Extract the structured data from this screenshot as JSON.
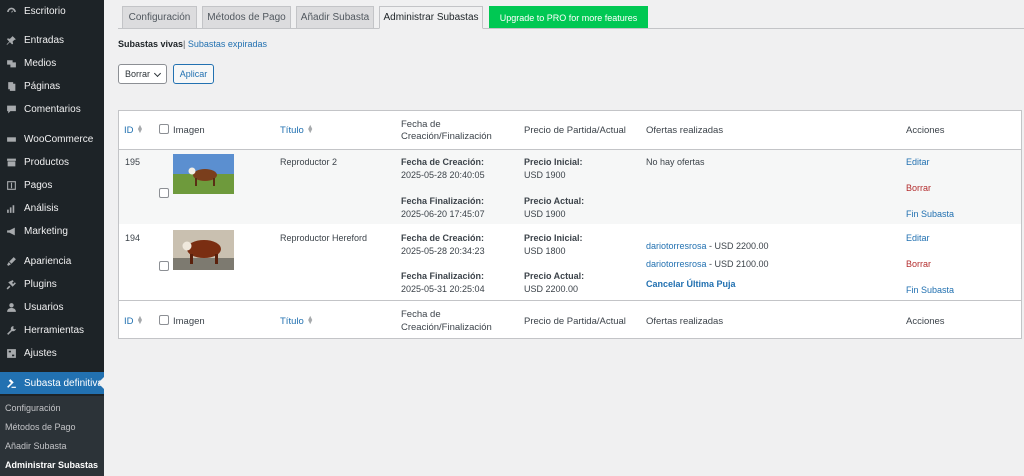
{
  "sidebar": {
    "items": [
      {
        "label": "Escritorio",
        "icon": "dashboard-icon"
      },
      {
        "label": "Entradas",
        "icon": "pin-icon"
      },
      {
        "label": "Medios",
        "icon": "media-icon"
      },
      {
        "label": "Páginas",
        "icon": "page-icon"
      },
      {
        "label": "Comentarios",
        "icon": "comment-icon"
      },
      {
        "label": "WooCommerce",
        "icon": "woocommerce-icon"
      },
      {
        "label": "Productos",
        "icon": "archive-icon"
      },
      {
        "label": "Pagos",
        "icon": "dollar-icon"
      },
      {
        "label": "Análisis",
        "icon": "chart-icon"
      },
      {
        "label": "Marketing",
        "icon": "megaphone-icon"
      },
      {
        "label": "Apariencia",
        "icon": "brush-icon"
      },
      {
        "label": "Plugins",
        "icon": "plugin-icon"
      },
      {
        "label": "Usuarios",
        "icon": "user-icon"
      },
      {
        "label": "Herramientas",
        "icon": "wrench-icon"
      },
      {
        "label": "Ajustes",
        "icon": "settings-icon"
      },
      {
        "label": "Subasta definitiva",
        "icon": "gavel-icon"
      }
    ],
    "submenu": [
      "Configuración",
      "Métodos de Pago",
      "Añadir Subasta",
      "Administrar Subastas"
    ]
  },
  "tabs": [
    "Configuración",
    "Métodos de Pago",
    "Añadir Subasta",
    "Administrar Subastas",
    "Upgrade to PRO for more features"
  ],
  "subsub": {
    "current": "Subastas vivas",
    "sep": "|",
    "other": "Subastas expiradas"
  },
  "bulk": {
    "select_value": "Borrar",
    "apply_label": "Aplicar"
  },
  "table": {
    "headers": {
      "id": "ID",
      "image": "Imagen",
      "title": "Título",
      "date_line1": "Fecha de",
      "date_line2": "Creación/Finalización",
      "price": "Precio de Partida/Actual",
      "bids": "Ofertas realizadas",
      "actions": "Acciones"
    },
    "rows": [
      {
        "id": "195",
        "title": "Reproductor 2",
        "created_label": "Fecha de Creación:",
        "created": "2025-05-28 20:40:05",
        "end_label": "Fecha Finalización:",
        "end": "2025-06-20 17:45:07",
        "initial_label": "Precio Inicial:",
        "initial": "USD 1900",
        "current_label": "Precio Actual:",
        "current": "USD 1900",
        "bids": {
          "none": "No hay ofertas"
        },
        "actions": {
          "edit": "Editar",
          "delete": "Borrar",
          "end": "Fin Subasta"
        }
      },
      {
        "id": "194",
        "title": "Reproductor Hereford",
        "created_label": "Fecha de Creación:",
        "created": "2025-05-28 20:34:23",
        "end_label": "Fecha Finalización:",
        "end": "2025-05-31 20:25:04",
        "initial_label": "Precio Inicial:",
        "initial": "USD 1800",
        "current_label": "Precio Actual:",
        "current": "USD 2200.00",
        "bids": {
          "list": [
            {
              "user": "dariotorresrosa",
              "amount": " - USD 2200.00"
            },
            {
              "user": "dariotorresrosa",
              "amount": " - USD 2100.00"
            }
          ],
          "cancel": "Cancelar Última Puja"
        },
        "actions": {
          "edit": "Editar",
          "delete": "Borrar",
          "end": "Fin Subasta"
        }
      }
    ]
  },
  "colors": {
    "sidebar": "#1d2327",
    "accent": "#2271b1",
    "pro": "#00c853",
    "danger": "#b32d2e"
  }
}
